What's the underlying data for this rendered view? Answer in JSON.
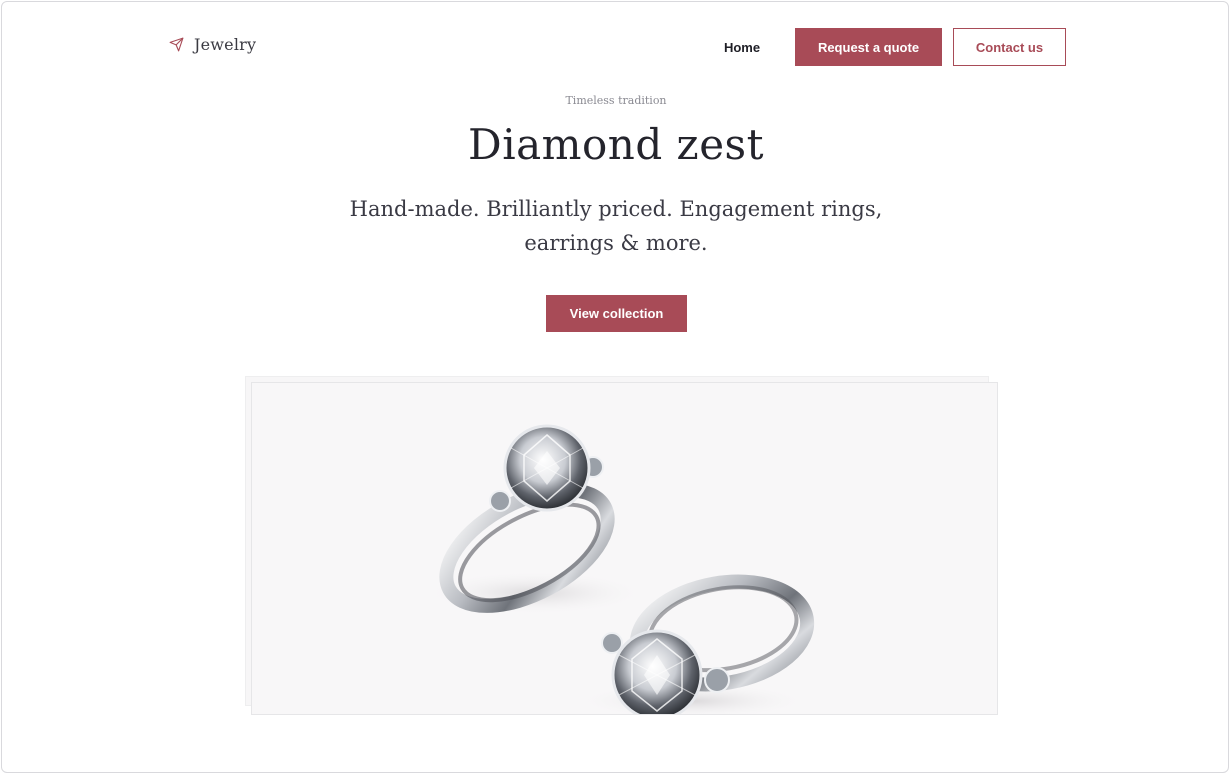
{
  "header": {
    "logo_text": "Jewelry",
    "logo_icon": "paper-plane-icon",
    "nav": {
      "home_label": "Home",
      "quote_label": "Request a quote",
      "contact_label": "Contact us"
    }
  },
  "hero": {
    "eyebrow": "Timeless tradition",
    "title": "Diamond zest",
    "subtitle": "Hand-made. Brilliantly priced. Engagement rings, earrings & more.",
    "cta_label": "View collection"
  },
  "image": {
    "subject": "two-diamond-rings-illustration"
  },
  "colors": {
    "accent": "#a84b57",
    "text_dark": "#24242c",
    "muted": "#8a8a92",
    "image_bg": "#f8f7f8"
  }
}
